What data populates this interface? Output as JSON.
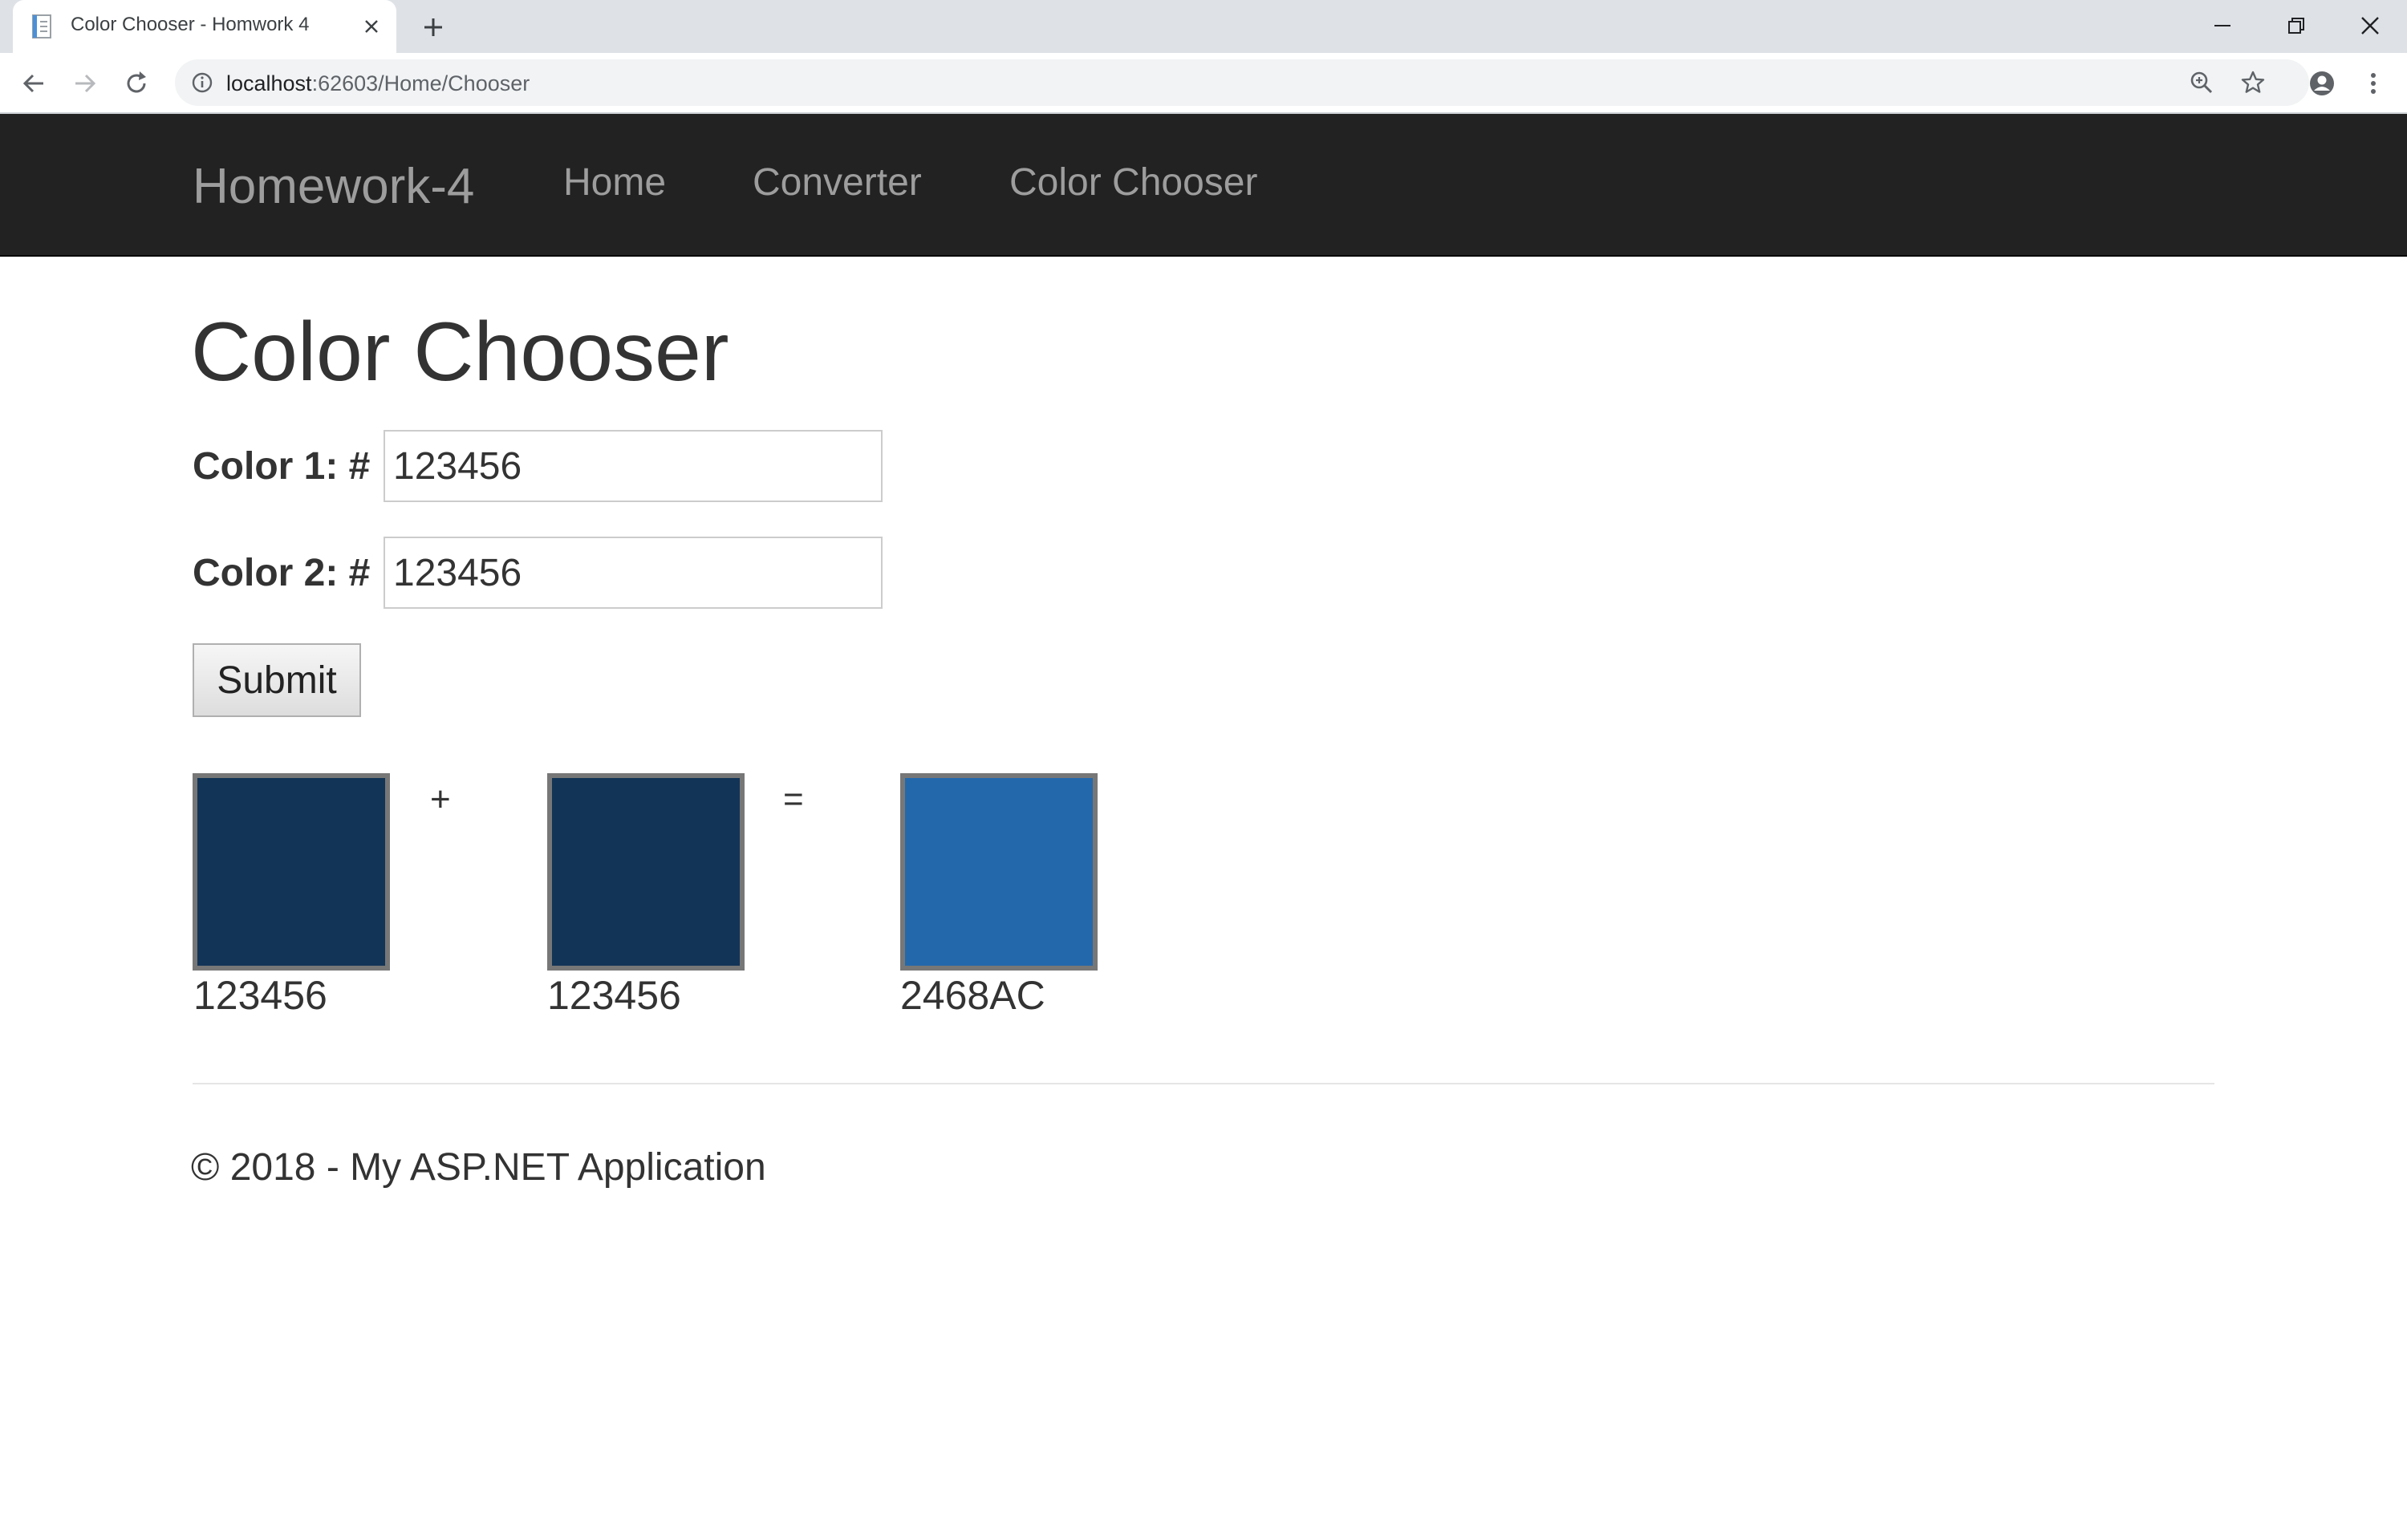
{
  "browser": {
    "tab_title": "Color Chooser - Homwork 4",
    "url_host": "localhost",
    "url_rest": ":62603/Home/Chooser"
  },
  "navbar": {
    "brand": "Homework-4",
    "links": [
      "Home",
      "Converter",
      "Color Chooser"
    ]
  },
  "page": {
    "title": "Color Chooser",
    "form": {
      "color1_label": "Color 1: #",
      "color1_value": "123456",
      "color2_label": "Color 2: #",
      "color2_value": "123456",
      "submit_label": "Submit"
    },
    "result": {
      "swatch1": {
        "hex": "123456",
        "color": "#123456"
      },
      "plus": "+",
      "swatch2": {
        "hex": "123456",
        "color": "#123456"
      },
      "equals": "=",
      "mix": {
        "hex": "2468AC",
        "color": "#2468AC"
      }
    }
  },
  "footer": {
    "text": "© 2018 - My ASP.NET Application"
  },
  "icons": [
    "page-favicon-icon",
    "close-icon",
    "plus-icon",
    "minimize-icon",
    "restore-icon",
    "close-window-icon",
    "back-arrow-icon",
    "forward-arrow-icon",
    "reload-icon",
    "info-icon",
    "zoom-icon",
    "star-icon",
    "account-icon",
    "more-vertical-icon"
  ]
}
